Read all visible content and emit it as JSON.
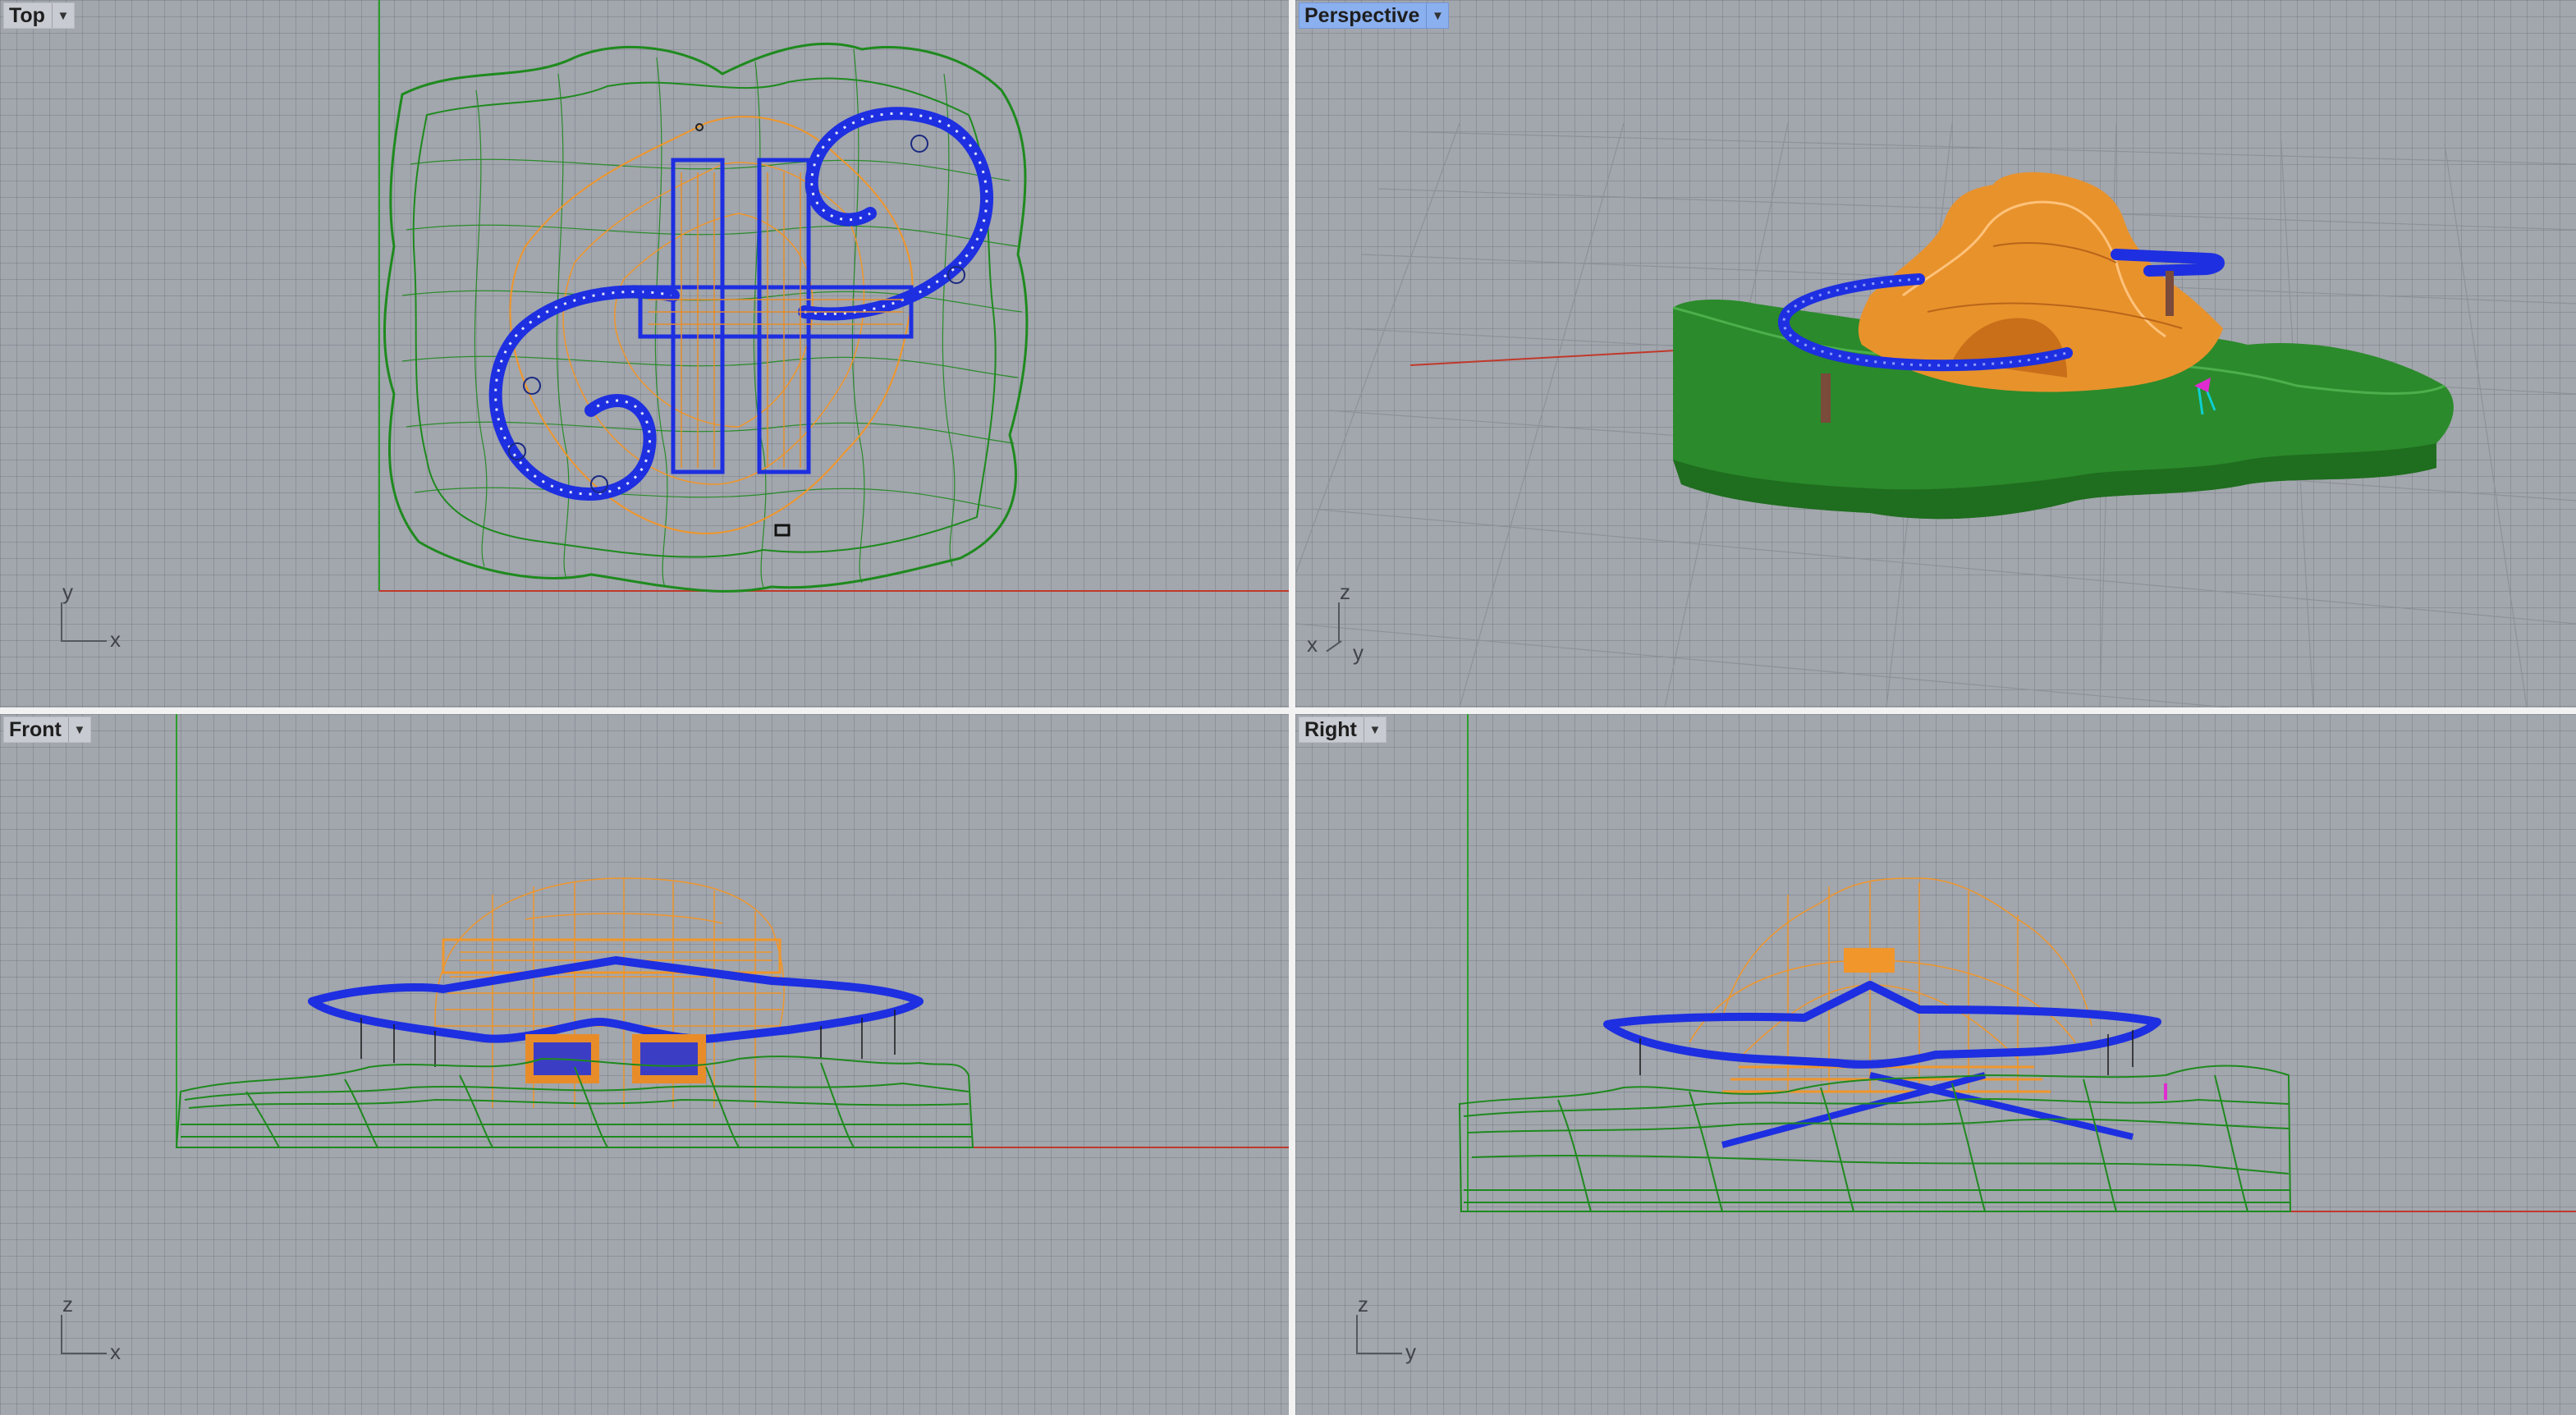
{
  "viewports": {
    "top": {
      "title": "Top",
      "axis_h": "x",
      "axis_v": "y"
    },
    "persp": {
      "title": "Perspective",
      "axis_a": "z",
      "axis_b": "x",
      "axis_c": "y"
    },
    "front": {
      "title": "Front",
      "axis_h": "x",
      "axis_v": "z"
    },
    "right": {
      "title": "Right",
      "axis_h": "y",
      "axis_v": "z"
    }
  },
  "icons": {
    "viewport_menu": "chevron-down-icon"
  },
  "colors": {
    "viewport_bg": "#a2a6ad",
    "active_tab": "#8ab0ef",
    "terrain": "#1e8a1e",
    "ramp": "#1d2fe0",
    "roof": "#f0962a",
    "x_axis": "#c0392b",
    "y_axis": "#2aa02a"
  }
}
